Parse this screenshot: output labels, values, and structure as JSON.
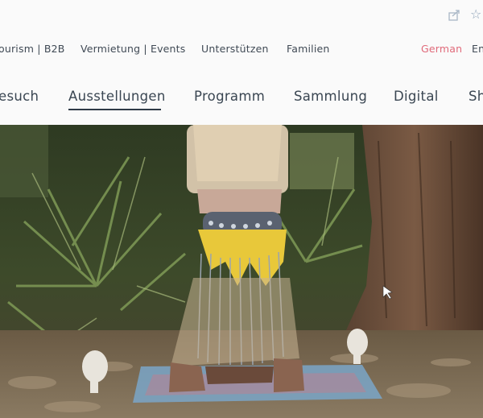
{
  "utility_nav": {
    "items": [
      "ourism | B2B",
      "Vermietung | Events",
      "Unterstützen",
      "Familien"
    ],
    "languages": [
      "German",
      "En"
    ]
  },
  "main_nav": {
    "items": [
      "esuch",
      "Ausstellungen",
      "Programm",
      "Sammlung",
      "Digital",
      "Sh"
    ],
    "active": "Ausstellungen"
  },
  "colors": {
    "accent_language": "#e06a7a",
    "text": "#3c4650"
  },
  "icons": [
    "share-icon",
    "star-icon"
  ]
}
